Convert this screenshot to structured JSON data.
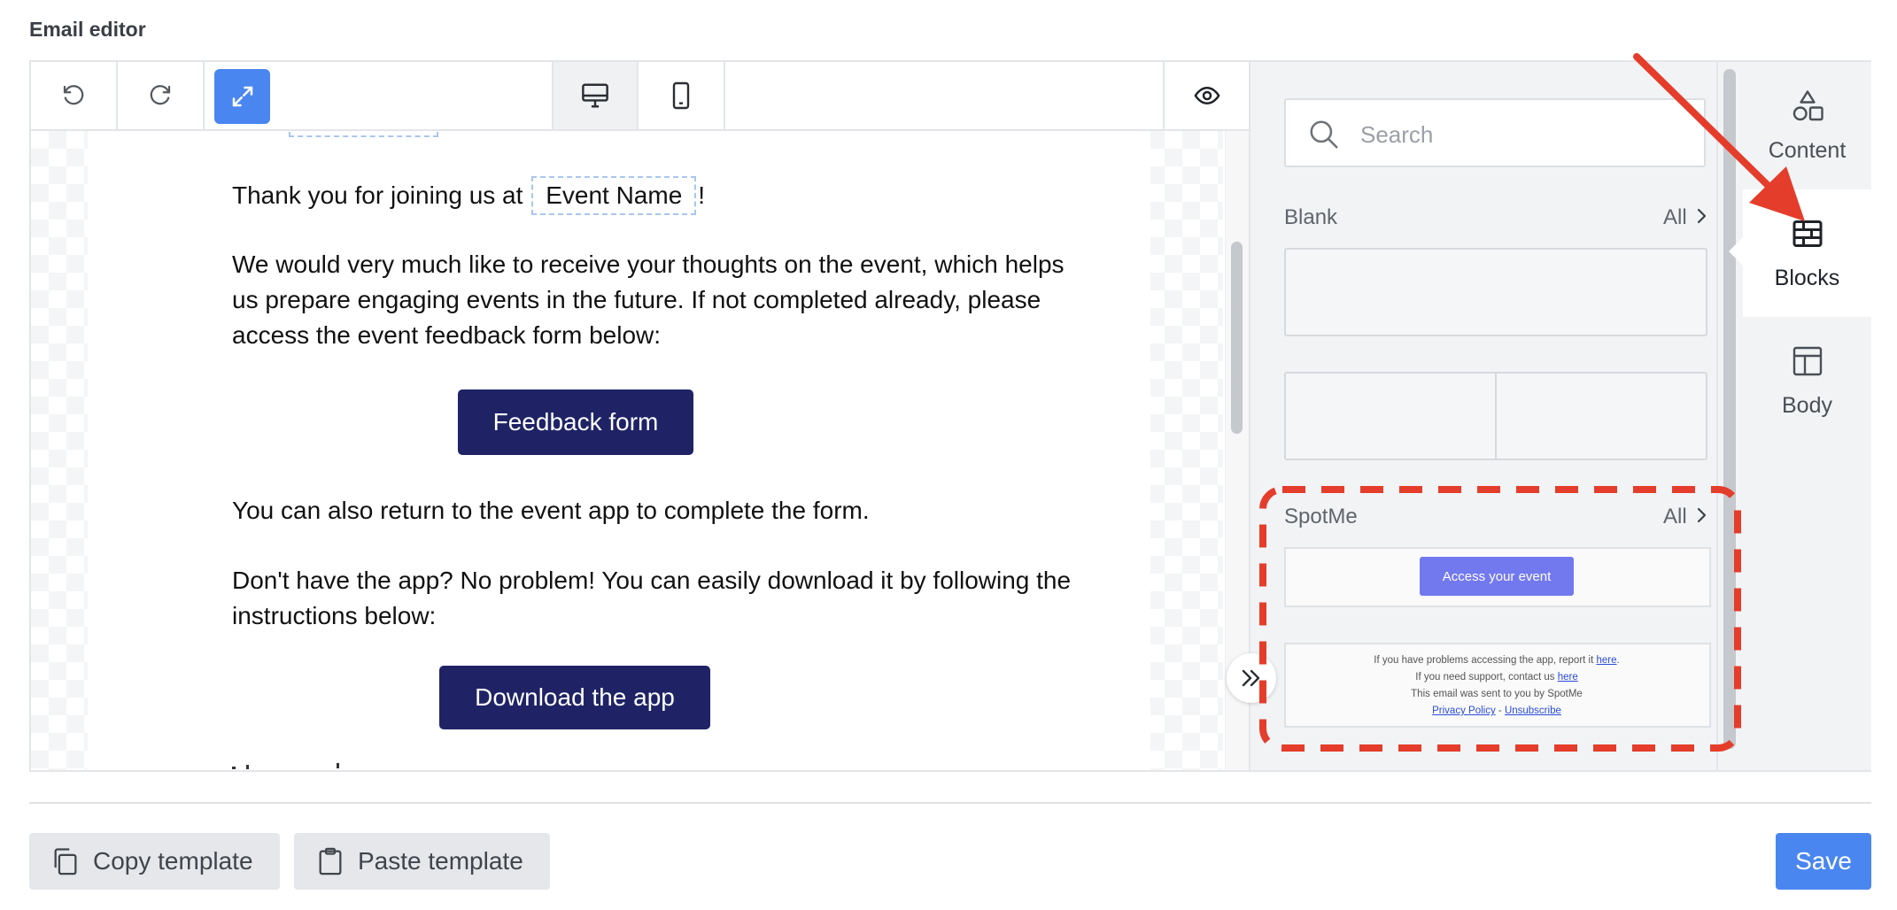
{
  "page_title": "Email editor",
  "toolbar": {
    "undo_icon": "undo-icon",
    "redo_icon": "redo-icon",
    "expand_icon": "expand-arrows-icon",
    "desktop_icon": "desktop-icon",
    "mobile_icon": "mobile-icon",
    "preview_icon": "eye-icon",
    "accent_color": "#4a86f0"
  },
  "email": {
    "intro_prefix": "Thank you for joining us at",
    "event_tag": "Event Name",
    "intro_suffix": "!",
    "paragraph1_line1": "We would very much like to receive your thoughts on the event, which helps",
    "paragraph1_line2": "us prepare engaging events in the future. If not completed already, please",
    "paragraph1_line3": "access the event feedback form below:",
    "feedback_button": "Feedback form",
    "paragraph2": "You can also return to the event app to complete the form.",
    "paragraph3_line1": "Don't have the app? No problem! You can easily download it by following the",
    "paragraph3_line2": "instructions below:",
    "download_button": "Download the app",
    "button_color": "#1f2366"
  },
  "panel": {
    "search_placeholder": "Search",
    "blank_section": {
      "title": "Blank",
      "all_label": "All"
    },
    "spotme_section": {
      "title": "SpotMe",
      "all_label": "All",
      "access_button": "Access your event",
      "footer_line1_prefix": "If you have problems accessing the app, report it ",
      "footer_line1_link": "here",
      "footer_line1_suffix": ".",
      "footer_line2_prefix": "If you need support, contact us ",
      "footer_line2_link": "here",
      "footer_line3": "This email was sent to you by SpotMe",
      "footer_privacy": "Privacy Policy",
      "footer_sep": " - ",
      "footer_unsubscribe": "Unsubscribe"
    }
  },
  "side_tabs": [
    {
      "label": "Content",
      "icon": "shapes-icon",
      "active": false
    },
    {
      "label": "Blocks",
      "icon": "blocks-icon",
      "active": true
    },
    {
      "label": "Body",
      "icon": "layout-icon",
      "active": false
    }
  ],
  "footer": {
    "copy_template": "Copy template",
    "paste_template": "Paste template",
    "save": "Save"
  },
  "annotation_color": "#e43d2b"
}
